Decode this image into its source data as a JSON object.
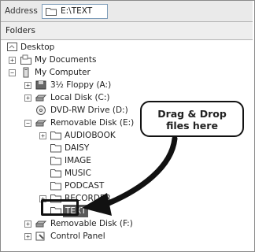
{
  "address": {
    "label": "Address",
    "path": "E:\\TEXT"
  },
  "folders_header": "Folders",
  "tree": {
    "desktop": "Desktop",
    "my_documents": "My Documents",
    "my_computer": "My Computer",
    "floppy": "3½ Floppy (A:)",
    "local_disk": "Local Disk (C:)",
    "dvd": "DVD-RW Drive (D:)",
    "removable_e": "Removable Disk (E:)",
    "audiobook": "AUDIOBOOK",
    "daisy": "DAISY",
    "image": "IMAGE",
    "music": "MUSIC",
    "podcast": "PODCAST",
    "recorder": "RECORDER",
    "text": "TEXT",
    "removable_f": "Removable Disk (F:)",
    "control_panel": "Control Panel"
  },
  "callout": {
    "line1": "Drag & Drop",
    "line2": "files here"
  },
  "colors": {
    "selection": "#5a5a5a",
    "callout_border": "#111111"
  }
}
